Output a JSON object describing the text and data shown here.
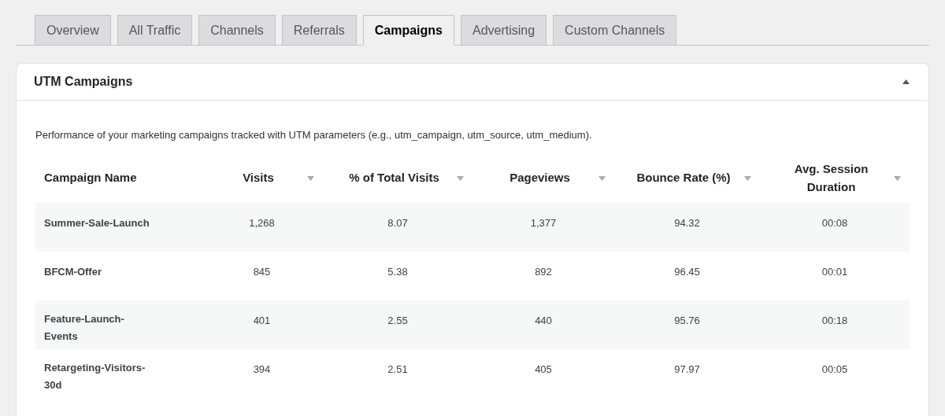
{
  "tabs": [
    {
      "label": "Overview",
      "selected": false
    },
    {
      "label": "All Traffic",
      "selected": false
    },
    {
      "label": "Channels",
      "selected": false
    },
    {
      "label": "Referrals",
      "selected": false
    },
    {
      "label": "Campaigns",
      "selected": true
    },
    {
      "label": "Advertising",
      "selected": false
    },
    {
      "label": "Custom Channels",
      "selected": false
    }
  ],
  "panel": {
    "title": "UTM Campaigns",
    "expanded": true,
    "description": "Performance of your marketing campaigns tracked with UTM parameters (e.g., utm_campaign, utm_source, utm_medium).",
    "table": {
      "columns": [
        {
          "label": "Campaign Name",
          "sortable": false
        },
        {
          "label": "Visits",
          "sortable": true
        },
        {
          "label": "% of Total Visits",
          "sortable": true
        },
        {
          "label": "Pageviews",
          "sortable": true
        },
        {
          "label": "Bounce Rate (%)",
          "sortable": true
        },
        {
          "label": "Avg. Session Duration",
          "sortable": true
        }
      ],
      "rows": [
        [
          "Summer-Sale-Launch",
          "1,268",
          "8.07",
          "1,377",
          "94.32",
          "00:08"
        ],
        [
          "BFCM-Offer",
          "845",
          "5.38",
          "892",
          "96.45",
          "00:01"
        ],
        [
          "Feature-Launch-Events",
          "401",
          "2.55",
          "440",
          "95.76",
          "00:18"
        ],
        [
          "Retargeting-Visitors-30d",
          "394",
          "2.51",
          "405",
          "97.97",
          "00:05"
        ]
      ]
    }
  }
}
